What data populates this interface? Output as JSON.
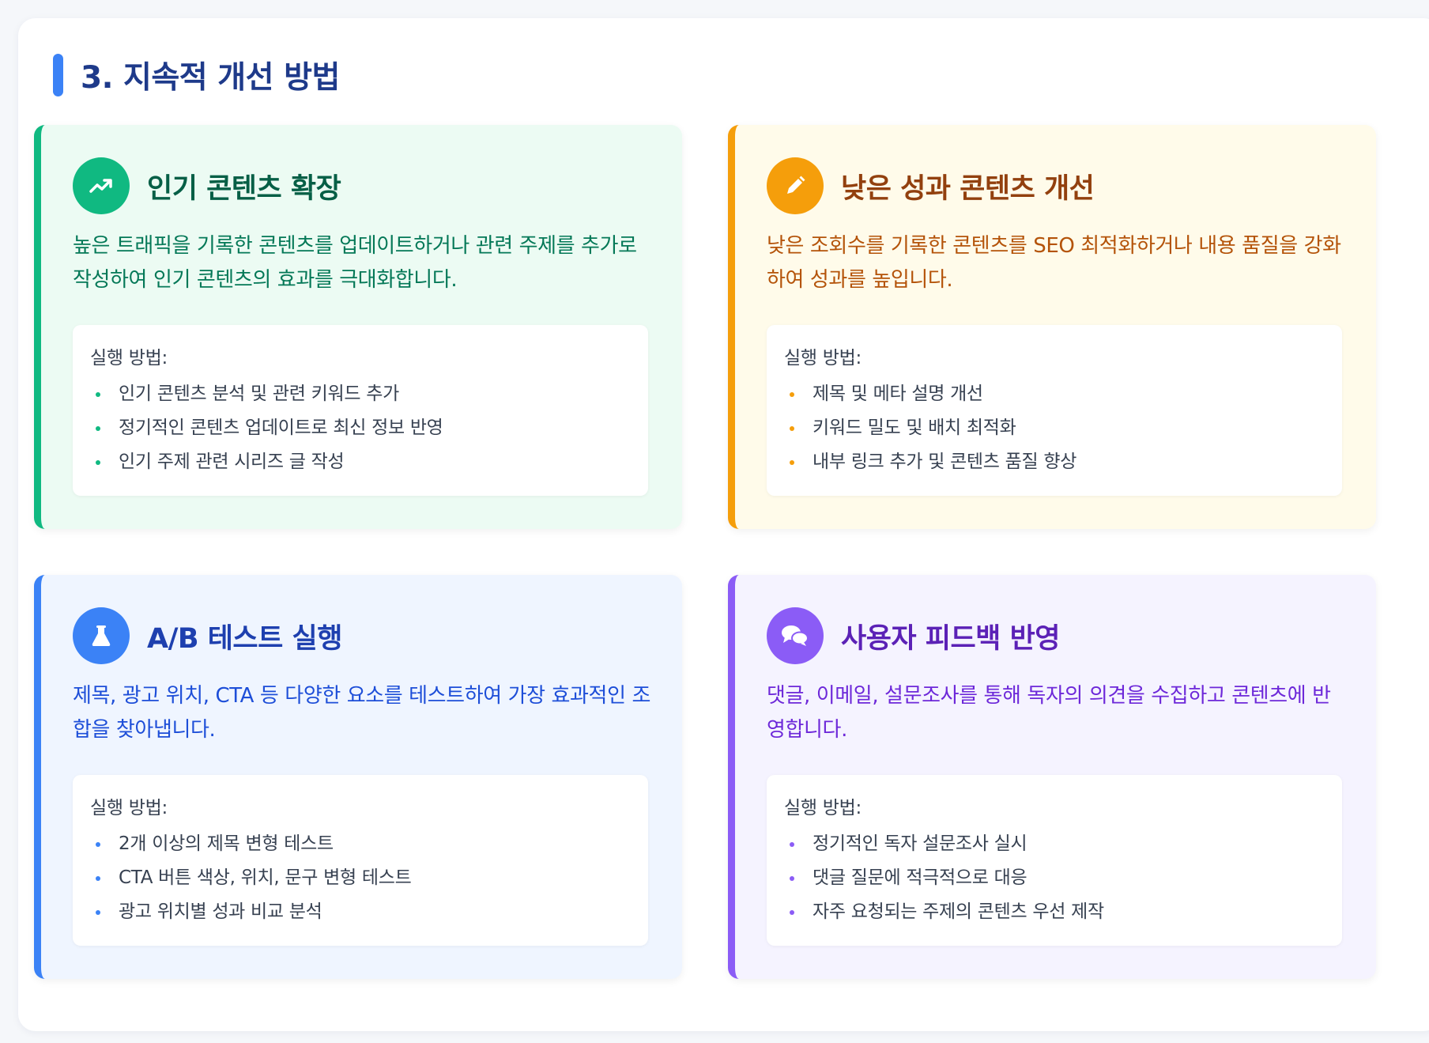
{
  "section": {
    "title": "3. 지속적 개선 방법"
  },
  "method_label": "실행 방법:",
  "cards": [
    {
      "icon": "trending-up-icon",
      "accent": "#10b981",
      "title": "인기 콘텐츠 확장",
      "description": "높은 트래픽을 기록한 콘텐츠를 업데이트하거나 관련 주제를 추가로 작성하여 인기 콘텐츠의 효과를 극대화합니다.",
      "methods": [
        "인기 콘텐츠 분석 및 관련 키워드 추가",
        "정기적인 콘텐츠 업데이트로 최신 정보 반영",
        "인기 주제 관련 시리즈 글 작성"
      ]
    },
    {
      "icon": "pencil-icon",
      "accent": "#f59e0b",
      "title": "낮은 성과 콘텐츠 개선",
      "description": "낮은 조회수를 기록한 콘텐츠를 SEO 최적화하거나 내용 품질을 강화하여 성과를 높입니다.",
      "methods": [
        "제목 및 메타 설명 개선",
        "키워드 밀도 및 배치 최적화",
        "내부 링크 추가 및 콘텐츠 품질 향상"
      ]
    },
    {
      "icon": "flask-icon",
      "accent": "#3b82f6",
      "title": "A/B 테스트 실행",
      "description": "제목, 광고 위치, CTA 등 다양한 요소를 테스트하여 가장 효과적인 조합을 찾아냅니다.",
      "methods": [
        "2개 이상의 제목 변형 테스트",
        "CTA 버튼 색상, 위치, 문구 변형 테스트",
        "광고 위치별 성과 비교 분석"
      ]
    },
    {
      "icon": "comments-icon",
      "accent": "#8b5cf6",
      "title": "사용자 피드백 반영",
      "description": "댓글, 이메일, 설문조사를 통해 독자의 의견을 수집하고 콘텐츠에 반영합니다.",
      "methods": [
        "정기적인 독자 설문조사 실시",
        "댓글 질문에 적극적으로 대응",
        "자주 요청되는 주제의 콘텐츠 우선 제작"
      ]
    }
  ]
}
